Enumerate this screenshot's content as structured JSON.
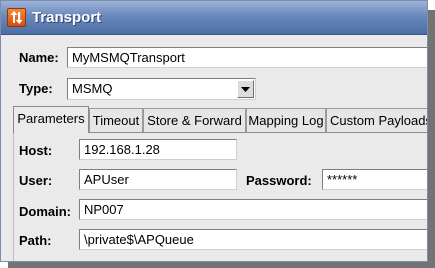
{
  "window": {
    "title": "Transport"
  },
  "form": {
    "name_label": "Name:",
    "name_value": "MyMSMQTransport",
    "type_label": "Type:",
    "type_value": "MSMQ"
  },
  "tabs": [
    {
      "label": "Parameters",
      "active": true
    },
    {
      "label": "Timeout",
      "active": false
    },
    {
      "label": "Store & Forward",
      "active": false
    },
    {
      "label": "Mapping Log",
      "active": false
    },
    {
      "label": "Custom Payloads",
      "active": false
    }
  ],
  "parameters": {
    "host_label": "Host:",
    "host_value": "192.168.1.28",
    "user_label": "User:",
    "user_value": "APUser",
    "password_label": "Password:",
    "password_value": "******",
    "domain_label": "Domain:",
    "domain_value": "NP007",
    "path_label": "Path:",
    "path_value": "\\private$\\APQueue"
  },
  "icons": {
    "title_icon": "transport-arrows-icon",
    "dropdown_icon": "chevron-down-icon"
  },
  "colors": {
    "titlebar": "#5a7ab0",
    "title_icon": "#e0601c",
    "background": "#eaeaea"
  }
}
